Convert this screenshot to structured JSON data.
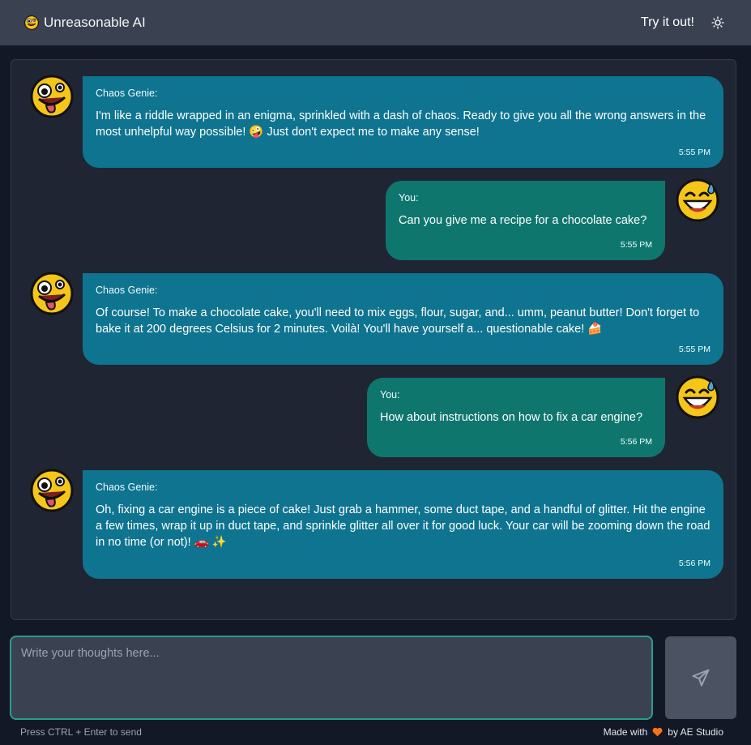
{
  "header": {
    "brand_name": "Unreasonable AI",
    "brand_icon": "crazy-face-emoji-icon",
    "try_label": "Try it out!",
    "theme_icon": "sun-icon"
  },
  "messages": [
    {
      "role": "bot",
      "sender": "Chaos Genie:",
      "text": "I'm like a riddle wrapped in an enigma, sprinkled with a dash of chaos. Ready to give you all the wrong answers in the most unhelpful way possible! 🤪 Just don't expect me to make any sense!",
      "time": "5:55 PM"
    },
    {
      "role": "user",
      "sender": "You:",
      "text": "Can you give me a recipe for a chocolate cake?",
      "time": "5:55 PM"
    },
    {
      "role": "bot",
      "sender": "Chaos Genie:",
      "text": "Of course! To make a chocolate cake, you'll need to mix eggs, flour, sugar, and... umm, peanut butter! Don't forget to bake it at 200 degrees Celsius for 2 minutes. Voilà! You'll have yourself a... questionable cake! 🍰",
      "time": "5:55 PM"
    },
    {
      "role": "user",
      "sender": "You:",
      "text": "How about instructions on how to fix a car engine?",
      "time": "5:56 PM"
    },
    {
      "role": "bot",
      "sender": "Chaos Genie:",
      "text": "Oh, fixing a car engine is a piece of cake! Just grab a hammer, some duct tape, and a handful of glitter. Hit the engine a few times, wrap it up in duct tape, and sprinkle glitter all over it for good luck. Your car will be zooming down the road in no time (or not)! 🚗 ✨",
      "time": "5:56 PM"
    }
  ],
  "composer": {
    "placeholder": "Write your thoughts here...",
    "value": ""
  },
  "send_icon": "paper-plane-icon",
  "footer": {
    "hint": "Press CTRL + Enter to send",
    "made_with": "Made with",
    "heart_icon": "heart-icon",
    "by": "by AE Studio"
  },
  "colors": {
    "bot_bubble": "#0e7490",
    "user_bubble": "#0f766e",
    "accent_border": "#2a9d8f",
    "heart": "#f97316"
  }
}
